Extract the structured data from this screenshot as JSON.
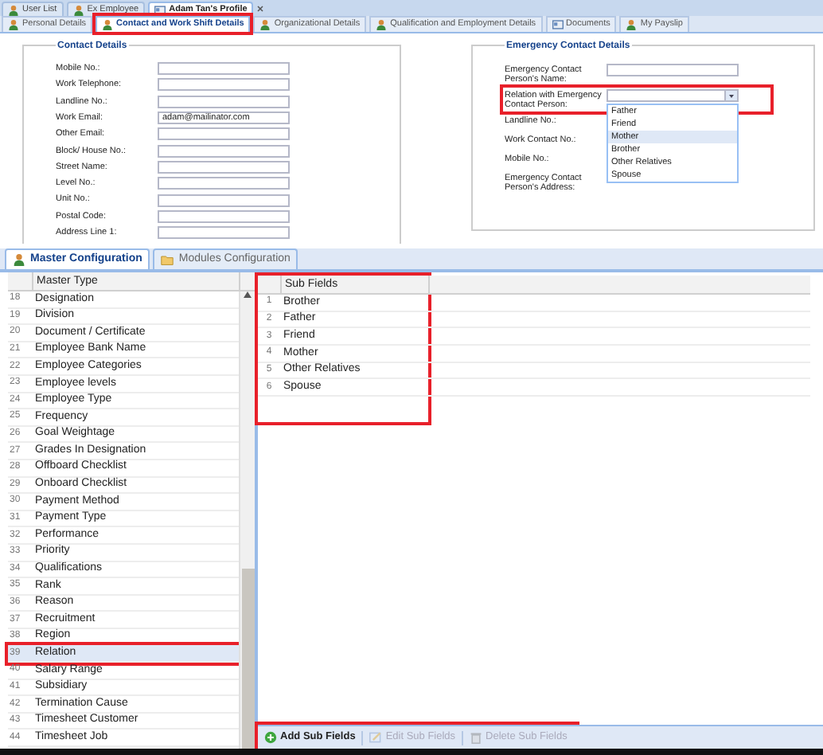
{
  "top_tabs": [
    {
      "label": "User List",
      "selected": false,
      "closable": false
    },
    {
      "label": "Ex Employee",
      "selected": false,
      "closable": false
    },
    {
      "label": "Adam Tan's Profile",
      "selected": true,
      "closable": true
    }
  ],
  "profile_tabs": [
    {
      "label": "Personal Details",
      "selected": false,
      "highlighted": false
    },
    {
      "label": "Contact and Work Shift Details",
      "selected": true,
      "highlighted": true
    },
    {
      "label": "Organizational Details",
      "selected": false,
      "highlighted": false
    },
    {
      "label": "Qualification and Employment Details",
      "selected": false,
      "highlighted": false
    },
    {
      "label": "Documents",
      "selected": false,
      "highlighted": false
    },
    {
      "label": "My Payslip",
      "selected": false,
      "highlighted": false
    }
  ],
  "contact_details": {
    "title": "Contact Details",
    "fields": [
      {
        "label": "Mobile No.:"
      },
      {
        "label": "Work Telephone:"
      },
      {
        "label": "Landline No.:"
      },
      {
        "label": "Work Email:",
        "value": "adam@mailinator.com"
      },
      {
        "label": "Other Email:"
      },
      {
        "label": "Block/ House No.:"
      },
      {
        "label": "Street Name:"
      },
      {
        "label": "Level No.:"
      },
      {
        "label": "Unit No.:"
      },
      {
        "label": "Postal Code:"
      },
      {
        "label": "Address Line 1:"
      }
    ]
  },
  "emergency_contact": {
    "title": "Emergency Contact Details",
    "fields": [
      {
        "label": "Emergency Contact Person's Name:",
        "kind": "text"
      },
      {
        "label": "Relation with Emergency Contact Person:",
        "kind": "select",
        "highlighted": true,
        "options": [
          {
            "label": "Father",
            "selected": false
          },
          {
            "label": "Friend",
            "selected": false
          },
          {
            "label": "Mother",
            "selected": true
          },
          {
            "label": "Brother",
            "selected": false
          },
          {
            "label": "Other Relatives",
            "selected": false
          },
          {
            "label": "Spouse",
            "selected": false
          }
        ]
      },
      {
        "label": "Landline No.:",
        "kind": "plain"
      },
      {
        "label": "Work Contact No.:",
        "kind": "plain"
      },
      {
        "label": "Mobile No.:",
        "kind": "plain"
      },
      {
        "label": "Emergency Contact Person's Address:",
        "kind": "plain"
      }
    ]
  },
  "config_tabs": [
    {
      "label": "Master Configuration",
      "selected": true
    },
    {
      "label": "Modules Configuration",
      "selected": false
    }
  ],
  "master_grid": {
    "column": "Master Type",
    "rows": [
      {
        "number": "18",
        "name": "Designation",
        "selected": false,
        "highlighted": false
      },
      {
        "number": "19",
        "name": "Division",
        "selected": false,
        "highlighted": false
      },
      {
        "number": "20",
        "name": "Document / Certificate",
        "selected": false,
        "highlighted": false
      },
      {
        "number": "21",
        "name": "Employee Bank Name",
        "selected": false,
        "highlighted": false
      },
      {
        "number": "22",
        "name": "Employee Categories",
        "selected": false,
        "highlighted": false
      },
      {
        "number": "23",
        "name": "Employee levels",
        "selected": false,
        "highlighted": false
      },
      {
        "number": "24",
        "name": "Employee Type",
        "selected": false,
        "highlighted": false
      },
      {
        "number": "25",
        "name": "Frequency",
        "selected": false,
        "highlighted": false
      },
      {
        "number": "26",
        "name": "Goal Weightage",
        "selected": false,
        "highlighted": false
      },
      {
        "number": "27",
        "name": "Grades In Designation",
        "selected": false,
        "highlighted": false
      },
      {
        "number": "28",
        "name": "Offboard Checklist",
        "selected": false,
        "highlighted": false
      },
      {
        "number": "29",
        "name": "Onboard Checklist",
        "selected": false,
        "highlighted": false
      },
      {
        "number": "30",
        "name": "Payment Method",
        "selected": false,
        "highlighted": false
      },
      {
        "number": "31",
        "name": "Payment Type",
        "selected": false,
        "highlighted": false
      },
      {
        "number": "32",
        "name": "Performance",
        "selected": false,
        "highlighted": false
      },
      {
        "number": "33",
        "name": "Priority",
        "selected": false,
        "highlighted": false
      },
      {
        "number": "34",
        "name": "Qualifications",
        "selected": false,
        "highlighted": false
      },
      {
        "number": "35",
        "name": "Rank",
        "selected": false,
        "highlighted": false
      },
      {
        "number": "36",
        "name": "Reason",
        "selected": false,
        "highlighted": false
      },
      {
        "number": "37",
        "name": "Recruitment",
        "selected": false,
        "highlighted": false
      },
      {
        "number": "38",
        "name": "Region",
        "selected": false,
        "highlighted": false
      },
      {
        "number": "39",
        "name": "Relation",
        "selected": true,
        "highlighted": true
      },
      {
        "number": "40",
        "name": "Salary Range",
        "selected": false,
        "highlighted": false
      },
      {
        "number": "41",
        "name": "Subsidiary",
        "selected": false,
        "highlighted": false
      },
      {
        "number": "42",
        "name": "Termination Cause",
        "selected": false,
        "highlighted": false
      },
      {
        "number": "43",
        "name": "Timesheet Customer",
        "selected": false,
        "highlighted": false
      },
      {
        "number": "44",
        "name": "Timesheet Job",
        "selected": false,
        "highlighted": false
      }
    ]
  },
  "sub_grid": {
    "column": "Sub Fields",
    "highlighted": true,
    "rows": [
      {
        "number": "1",
        "name": "Brother"
      },
      {
        "number": "2",
        "name": "Father"
      },
      {
        "number": "3",
        "name": "Friend"
      },
      {
        "number": "4",
        "name": "Mother"
      },
      {
        "number": "5",
        "name": "Other Relatives"
      },
      {
        "number": "6",
        "name": "Spouse"
      }
    ]
  },
  "toolbar": {
    "highlighted": true,
    "buttons": [
      {
        "label": "Add Sub Fields",
        "kind": "add",
        "disabled": false
      },
      {
        "label": "Edit Sub Fields",
        "kind": "edit",
        "disabled": true
      },
      {
        "label": "Delete Sub Fields",
        "kind": "delete",
        "disabled": true
      }
    ]
  }
}
